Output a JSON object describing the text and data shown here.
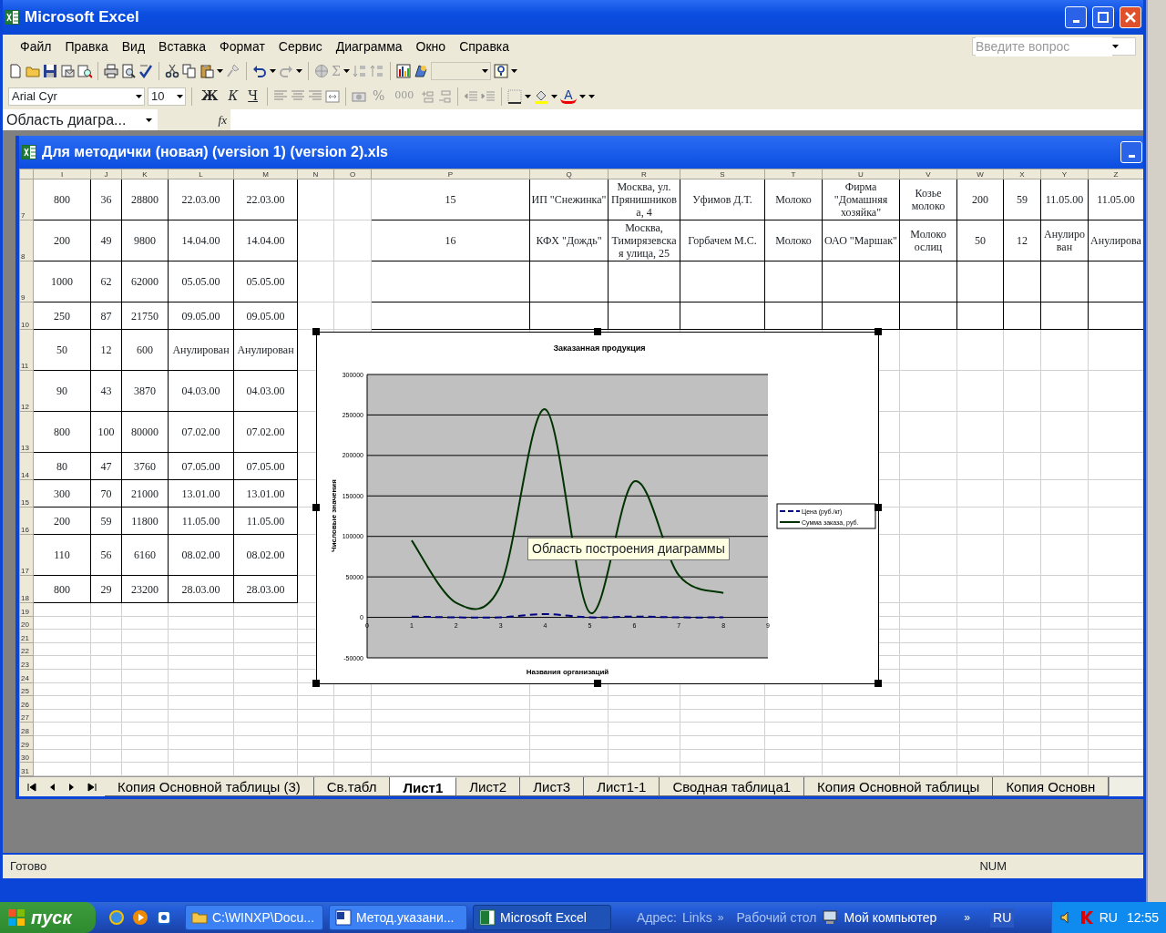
{
  "window": {
    "title": "Microsoft Excel"
  },
  "menu": [
    "Файл",
    "Правка",
    "Вид",
    "Вставка",
    "Формат",
    "Сервис",
    "Диаграмма",
    "Окно",
    "Справка"
  ],
  "help_box": {
    "placeholder": "Введите вопрос"
  },
  "toolbar_glyphs": {
    "sum": "Σ",
    "bold": "Ж",
    "italic": "К",
    "underline": "Ч",
    "percent": "%",
    "thousands": "000",
    "font_color": "A"
  },
  "formatting": {
    "font": "Arial Cyr",
    "size": "10"
  },
  "formula_bar": {
    "name_box": "Область диагра...",
    "fx": "fx"
  },
  "workbook": {
    "title": "Для методички (новая) (version 1) (version 2).xls"
  },
  "columns": [
    "I",
    "J",
    "K",
    "L",
    "M",
    "N",
    "O",
    "P",
    "Q",
    "R",
    "S",
    "T",
    "U",
    "V",
    "W",
    "X",
    "Y",
    "Z"
  ],
  "rows": [
    {
      "number": "7",
      "cells": [
        "800",
        "36",
        "28800",
        "22.03.00",
        "22.03.00",
        null,
        null,
        "15",
        "ИП \"Снежинка\"",
        "Москва, ул. Прянишникова, 4",
        "Уфимов Д.Т.",
        "Молоко",
        "Фирма \"Домашняя хозяйка\"",
        "Козье молоко",
        "200",
        "59",
        "11.05.00",
        "11.05.00"
      ]
    },
    {
      "number": "8",
      "cells": [
        "200",
        "49",
        "9800",
        "14.04.00",
        "14.04.00",
        null,
        null,
        "16",
        "КФХ \"Дождь\"",
        "Москва, Тимирязевская улица, 25",
        "Горбачем М.С.",
        "Молоко",
        "ОАО \"Маршак\"",
        "Молоко ослиц",
        "50",
        "12",
        "Анулирован",
        "Анулирова"
      ]
    },
    {
      "number": "9",
      "cells": [
        "1000",
        "62",
        "62000",
        "05.05.00",
        "05.05.00"
      ]
    },
    {
      "number": "10",
      "cells": [
        "250",
        "87",
        "21750",
        "09.05.00",
        "09.05.00"
      ]
    },
    {
      "number": "11",
      "cells": [
        "50",
        "12",
        "600",
        "Анулирован",
        "Анулирован"
      ]
    },
    {
      "number": "12",
      "cells": [
        "90",
        "43",
        "3870",
        "04.03.00",
        "04.03.00"
      ]
    },
    {
      "number": "13",
      "cells": [
        "800",
        "100",
        "80000",
        "07.02.00",
        "07.02.00"
      ]
    },
    {
      "number": "14",
      "cells": [
        "80",
        "47",
        "3760",
        "07.05.00",
        "07.05.00"
      ]
    },
    {
      "number": "15",
      "cells": [
        "300",
        "70",
        "21000",
        "13.01.00",
        "13.01.00"
      ]
    },
    {
      "number": "16",
      "cells": [
        "200",
        "59",
        "11800",
        "11.05.00",
        "11.05.00"
      ]
    },
    {
      "number": "17",
      "cells": [
        "110",
        "56",
        "6160",
        "08.02.00",
        "08.02.00"
      ]
    },
    {
      "number": "18",
      "cells": [
        "800",
        "29",
        "23200",
        "28.03.00",
        "28.03.00"
      ]
    },
    {
      "number": "19"
    },
    {
      "number": "20"
    },
    {
      "number": "21"
    },
    {
      "number": "22"
    },
    {
      "number": "23"
    },
    {
      "number": "24"
    },
    {
      "number": "25"
    },
    {
      "number": "26"
    },
    {
      "number": "27"
    },
    {
      "number": "28"
    },
    {
      "number": "29"
    },
    {
      "number": "30"
    },
    {
      "number": "31"
    }
  ],
  "chart": {
    "tooltip": "Область построения диаграммы",
    "chart_data": {
      "type": "line",
      "title": "Заказанная продукция",
      "xlabel": "Названия организаций",
      "ylabel": "Числовые значения",
      "x": [
        1,
        2,
        3,
        4,
        5,
        6,
        7,
        8
      ],
      "series": [
        {
          "name": "Цена (руб./кг)",
          "color": "#000080",
          "line_style": "dashed",
          "values": [
            1000,
            0,
            0,
            4000,
            0,
            1000,
            0,
            0
          ]
        },
        {
          "name": "Сумма заказа, руб.",
          "color": "#003300",
          "line_style": "solid",
          "values": [
            95000,
            18000,
            40000,
            257000,
            6000,
            168000,
            52000,
            30000
          ]
        }
      ],
      "grid": true,
      "legend": true,
      "xlim": [
        0,
        9
      ],
      "ylim": [
        -50000,
        300000
      ],
      "xticks": [
        0,
        1,
        2,
        3,
        4,
        5,
        6,
        7,
        8,
        9
      ],
      "yticks": [
        -50000,
        0,
        50000,
        100000,
        150000,
        200000,
        250000,
        300000
      ]
    }
  },
  "sheet_tabs": [
    {
      "label": "Копия Основной таблицы (3)",
      "selected": false
    },
    {
      "label": "Св.табл",
      "selected": false
    },
    {
      "label": "Лист1",
      "selected": true
    },
    {
      "label": "Лист2",
      "selected": false
    },
    {
      "label": "Лист3",
      "selected": false
    },
    {
      "label": "Лист1-1",
      "selected": false
    },
    {
      "label": "Сводная таблица1",
      "selected": false
    },
    {
      "label": "Копия Основной таблицы",
      "selected": false
    },
    {
      "label": "Копия Основн",
      "selected": false
    }
  ],
  "status_bar": {
    "text": "Готово",
    "num": "NUM"
  },
  "taskbar": {
    "start": "пуск",
    "tasks": [
      {
        "label": "C:\\WINXP\\Docu...",
        "selected": false
      },
      {
        "label": "Метод.указани...",
        "selected": false
      },
      {
        "label": "Microsoft Excel",
        "selected": true
      }
    ],
    "address": "Адрес:",
    "links": "Links",
    "chevron": "»",
    "desktop": "Рабочий стол",
    "my_computer": "Мой компьютер",
    "chevron_2": "»",
    "lang": "RU",
    "tray_lang": "RU",
    "clock": "12:55"
  }
}
